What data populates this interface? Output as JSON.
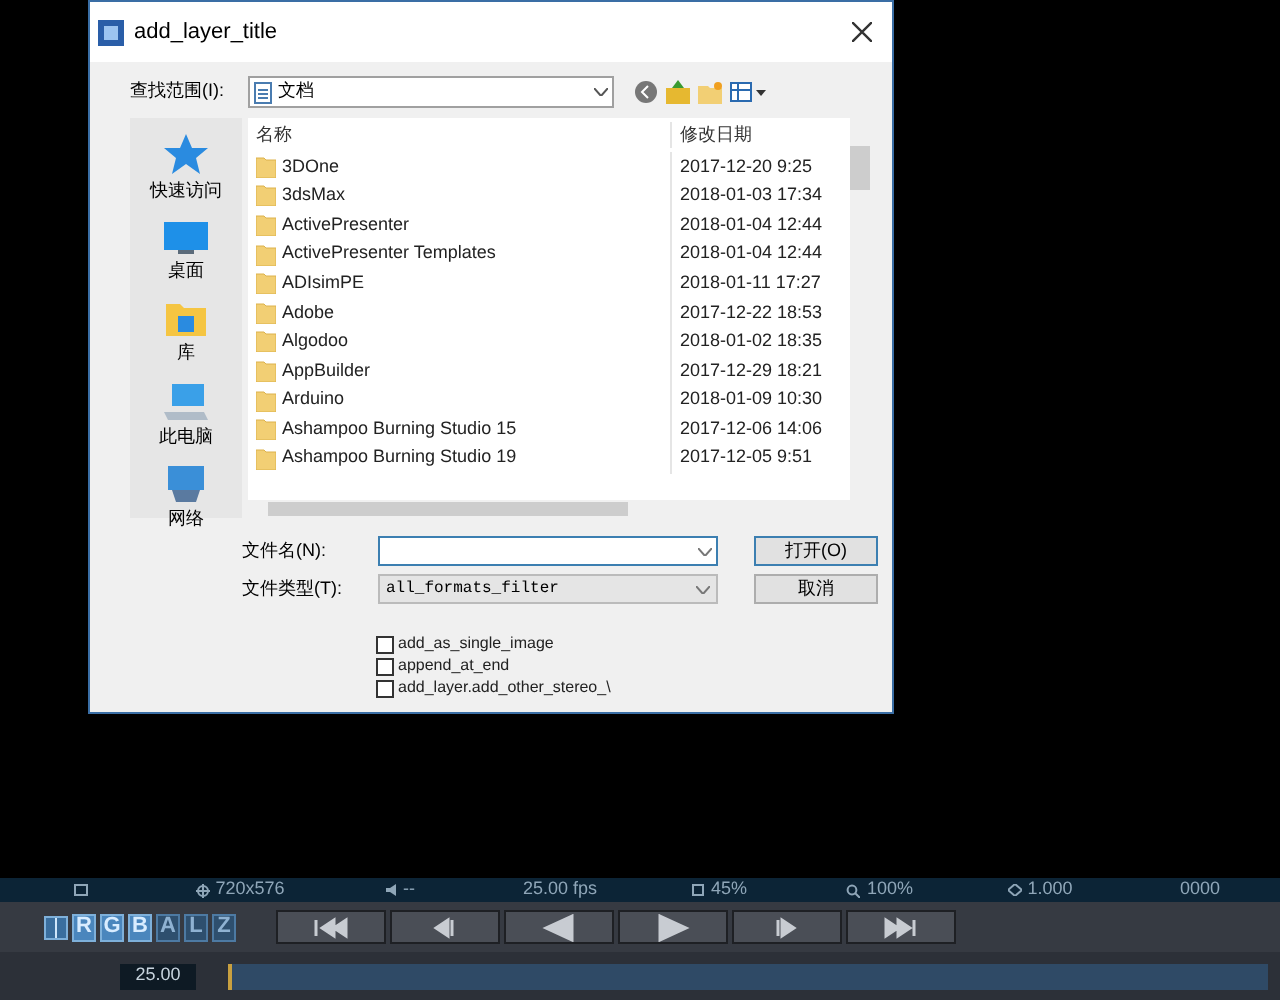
{
  "dialog": {
    "title": "add_layer_title",
    "look_in_label": "查找范围(I):",
    "look_in_value": "文档",
    "places": [
      {
        "label": "快速访问",
        "kind": "star"
      },
      {
        "label": "桌面",
        "kind": "desktop"
      },
      {
        "label": "库",
        "kind": "library"
      },
      {
        "label": "此电脑",
        "kind": "computer"
      },
      {
        "label": "网络",
        "kind": "network"
      }
    ],
    "columns": [
      "名称",
      "修改日期"
    ],
    "files": [
      {
        "name": "3DOne",
        "date": "2017-12-20 9:25"
      },
      {
        "name": "3dsMax",
        "date": "2018-01-03 17:34"
      },
      {
        "name": "ActivePresenter",
        "date": "2018-01-04 12:44"
      },
      {
        "name": "ActivePresenter Templates",
        "date": "2018-01-04 12:44"
      },
      {
        "name": "ADIsimPE",
        "date": "2018-01-11 17:27"
      },
      {
        "name": "Adobe",
        "date": "2017-12-22 18:53"
      },
      {
        "name": "Algodoo",
        "date": "2018-01-02 18:35"
      },
      {
        "name": "AppBuilder",
        "date": "2017-12-29 18:21"
      },
      {
        "name": "Arduino",
        "date": "2018-01-09 10:30"
      },
      {
        "name": "Ashampoo Burning Studio 15",
        "date": "2017-12-06 14:06"
      },
      {
        "name": "Ashampoo Burning Studio 19",
        "date": "2017-12-05 9:51"
      }
    ],
    "filename_label": "文件名(N):",
    "filetype_label": "文件类型(T):",
    "filetype_value": "all_formats_filter",
    "buttons": [
      "打开(O)",
      "取消"
    ],
    "options": [
      {
        "label": "add_as_single_image",
        "checked": false
      },
      {
        "label": "append_at_end",
        "checked": false
      },
      {
        "label": "add_layer.add_other_stereo_\\",
        "checked": false
      }
    ]
  },
  "status_bar": [
    {
      "kind": "frame"
    },
    {
      "kind": "size",
      "text": "720x576"
    },
    {
      "kind": "audio",
      "text": "--"
    },
    {
      "kind": "plain",
      "text": "25.00 fps"
    },
    {
      "kind": "memory",
      "text": "45%"
    },
    {
      "kind": "zoom",
      "text": "100%"
    },
    {
      "kind": "ratio",
      "text": "1.000"
    },
    {
      "kind": "plain",
      "text": "0000"
    }
  ],
  "channels": [
    {
      "label": "R",
      "selected": true
    },
    {
      "label": "G",
      "selected": true
    },
    {
      "label": "B",
      "selected": true
    },
    {
      "label": "A",
      "selected": false
    },
    {
      "label": "L",
      "selected": false
    },
    {
      "label": "Z",
      "selected": false
    }
  ],
  "transport": [
    {
      "kind": "first"
    },
    {
      "kind": "back-step"
    },
    {
      "kind": "reverse"
    },
    {
      "kind": "play"
    },
    {
      "kind": "step"
    },
    {
      "kind": "last"
    }
  ],
  "time_value": "25.00"
}
